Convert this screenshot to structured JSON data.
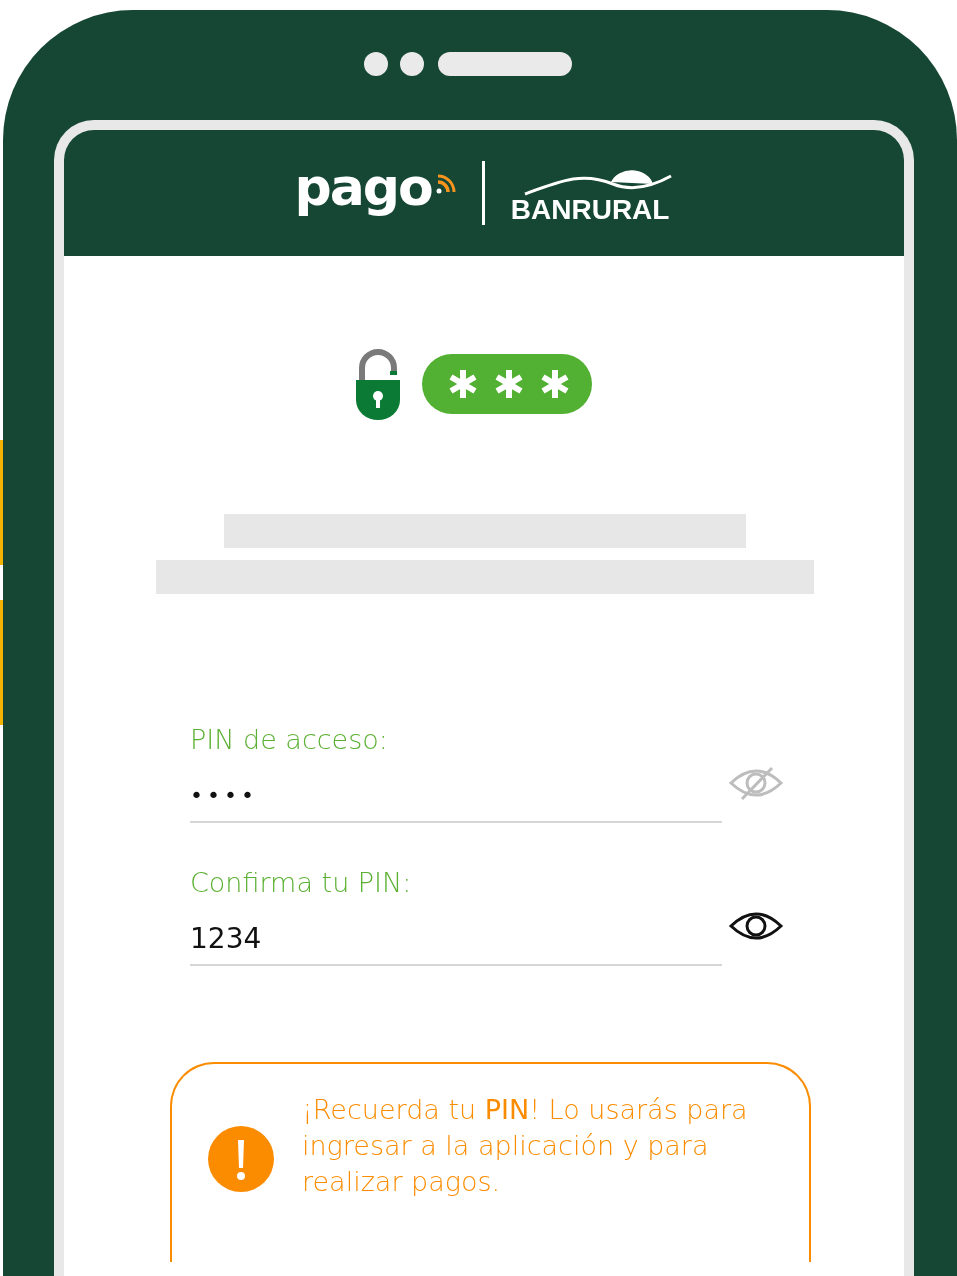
{
  "header": {
    "app_logo": "pago",
    "bank_logo": "BANRURAL"
  },
  "fields": [
    {
      "label": "PIN de acceso:",
      "value": "••••",
      "masked": true
    },
    {
      "label": "Confirma tu PIN:",
      "value": "1234",
      "masked": false
    }
  ],
  "notice": {
    "text": "¡Recuerda tu **PIN**! Lo usarás para ingresar a la aplicación y para realizar pagos."
  }
}
